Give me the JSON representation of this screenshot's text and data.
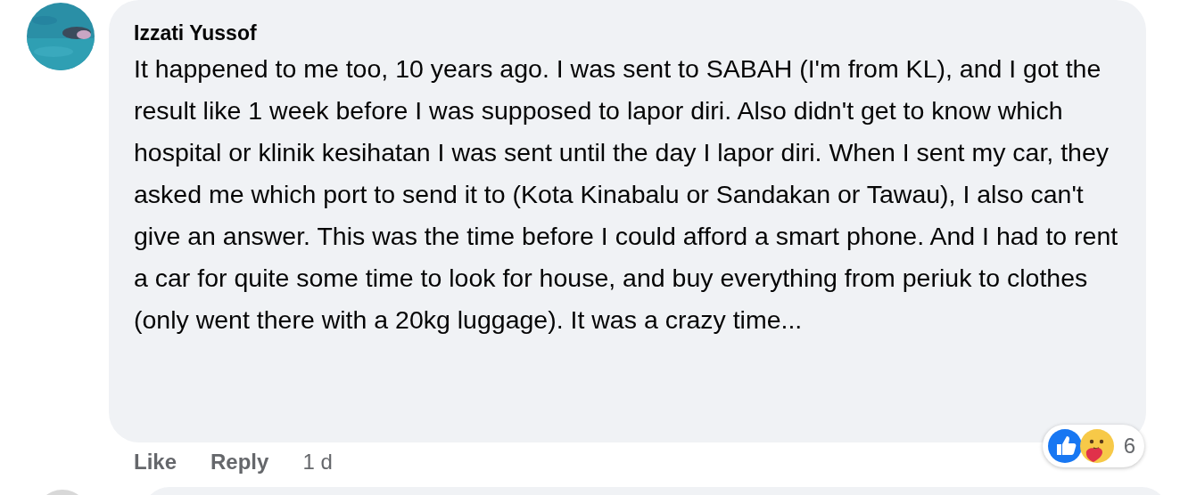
{
  "comment": {
    "author": "Izzati Yussof",
    "text": "It happened to me too, 10 years ago. I was sent to SABAH (I'm from KL), and I got the result like 1 week before I was supposed to lapor diri. Also didn't get to know which hospital or klinik kesihatan I was sent until the day I lapor diri. When I sent my car, they asked me which port to send it to (Kota Kinabalu or Sandakan or Tawau), I also can't give an answer. This was the time before I could afford a smart phone. And I had to rent a car for quite some time to look for house, and buy everything from periuk to clothes (only went there with a 20kg luggage). It was a crazy time...",
    "reactions": [
      {
        "kind": "like"
      },
      {
        "kind": "care"
      }
    ],
    "reaction_count": "6",
    "actions": [
      "Like",
      "Reply"
    ],
    "time": "1 d"
  }
}
